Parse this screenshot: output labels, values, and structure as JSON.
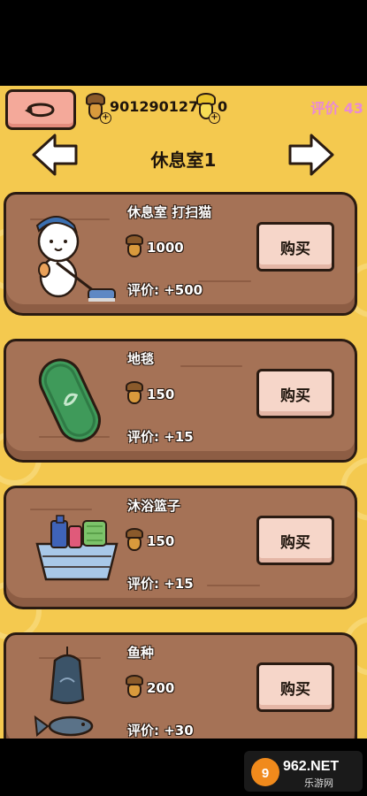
{
  "hud": {
    "acorn_count": "901290127",
    "gold_count": "0",
    "rating_label": "评价 43",
    "plus": "+"
  },
  "nav": {
    "title": "休息室1"
  },
  "items": [
    {
      "name": "休息室 打扫猫",
      "price": "1000",
      "bonus": "评价: +500",
      "buy": "购买",
      "icon": "sweeping-cat"
    },
    {
      "name": "地毯",
      "price": "150",
      "bonus": "评价: +15",
      "buy": "购买",
      "icon": "green-rug"
    },
    {
      "name": "沐浴篮子",
      "price": "150",
      "bonus": "评价: +15",
      "buy": "购买",
      "icon": "bath-basket"
    },
    {
      "name": "鱼种",
      "price": "200",
      "bonus": "评价: +30",
      "buy": "购买",
      "icon": "fish-seed"
    }
  ],
  "watermark": {
    "brand": "962.NET",
    "sub": "乐游网"
  },
  "colors": {
    "background": "#f4c94f",
    "plank": "#a57256",
    "buy_button": "#f6d6c9",
    "rating": "#e98ad6"
  }
}
